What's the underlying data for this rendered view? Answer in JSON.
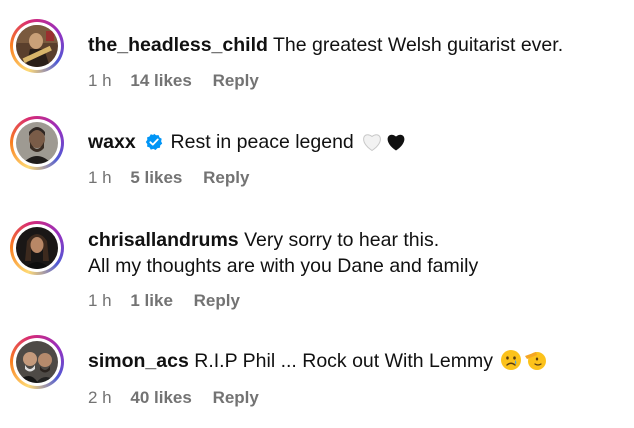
{
  "comments": [
    {
      "username": "the_headless_child",
      "verified": false,
      "lines": [
        "The greatest Welsh guitarist ever."
      ],
      "time": "1 h",
      "likes": "14 likes",
      "reply": "Reply",
      "avatar": "guitarist-photo"
    },
    {
      "username": "waxx",
      "verified": true,
      "lines": [
        "Rest in peace legend"
      ],
      "emojis": [
        "white-heart-icon",
        "black-heart-icon"
      ],
      "time": "1 h",
      "likes": "5 likes",
      "reply": "Reply",
      "avatar": "bearded-man-photo"
    },
    {
      "username": "chrisallandrums",
      "verified": false,
      "lines": [
        "Very sorry to hear this.",
        "All my thoughts are with you Dane and family"
      ],
      "time": "1 h",
      "likes": "1 like",
      "reply": "Reply",
      "avatar": "long-hair-man-photo"
    },
    {
      "username": "simon_acs",
      "verified": false,
      "lines": [
        "R.I.P Phil ... Rock out With Lemmy"
      ],
      "emojis": [
        "crying-face-icon",
        "salute-face-icon"
      ],
      "time": "2 h",
      "likes": "40 likes",
      "reply": "Reply",
      "avatar": "two-men-photo"
    }
  ],
  "colors": {
    "text": "#111111",
    "meta": "#737373",
    "verified": "#0095f6",
    "story_ring": [
      "#feda75",
      "#fa7e1e",
      "#d62976",
      "#962fbf",
      "#4f5bd5"
    ]
  }
}
